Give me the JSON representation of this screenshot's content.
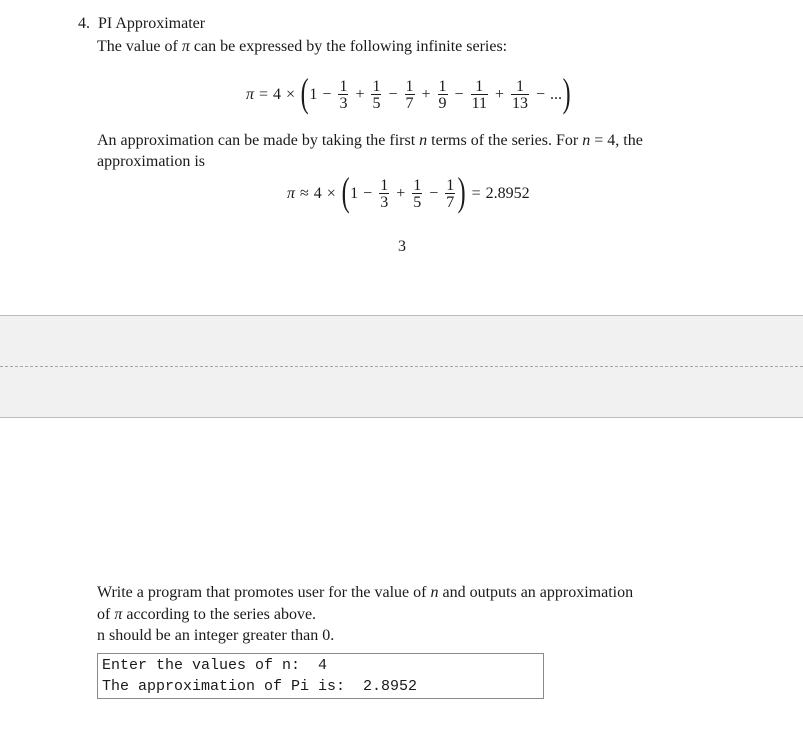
{
  "problem": {
    "number": "4.",
    "title": "PI Approximater",
    "intro_pre": "The value of ",
    "pi": "π",
    "intro_post": " can be expressed by the following infinite series:"
  },
  "series_formula": {
    "lhs": "π",
    "eq": "=",
    "coef": "4",
    "times": "×",
    "first": "1",
    "terms": [
      {
        "sign": "−",
        "num": "1",
        "den": "3"
      },
      {
        "sign": "+",
        "num": "1",
        "den": "5"
      },
      {
        "sign": "−",
        "num": "1",
        "den": "7"
      },
      {
        "sign": "+",
        "num": "1",
        "den": "9"
      },
      {
        "sign": "−",
        "num": "1",
        "den": "11"
      },
      {
        "sign": "+",
        "num": "1",
        "den": "13"
      }
    ],
    "tail_sign": "−",
    "ellipsis": "..."
  },
  "approx_text": {
    "line1_a": "An approximation can be made by taking the first ",
    "n": "n",
    "line1_b": " terms of the series. For ",
    "n2": "n",
    "line1_c": " = 4, the",
    "line2": "approximation is"
  },
  "approx_formula": {
    "lhs": "π",
    "approx": "≈",
    "coef": "4",
    "times": "×",
    "first": "1",
    "terms": [
      {
        "sign": "−",
        "num": "1",
        "den": "3"
      },
      {
        "sign": "+",
        "num": "1",
        "den": "5"
      },
      {
        "sign": "−",
        "num": "1",
        "den": "7"
      }
    ],
    "eq": "=",
    "result": "2.8952"
  },
  "page_number": "3",
  "task": {
    "line1_a": "Write a program that promotes user for the value of ",
    "n": "n",
    "line1_b": " and outputs an approximation",
    "line2_a": "of ",
    "pi": "π",
    "line2_b": " according to the series above.",
    "line3": "n should be an integer greater than 0."
  },
  "console": {
    "lines": [
      "Enter the values of n:  4",
      "The approximation of Pi is:  2.8952"
    ]
  }
}
